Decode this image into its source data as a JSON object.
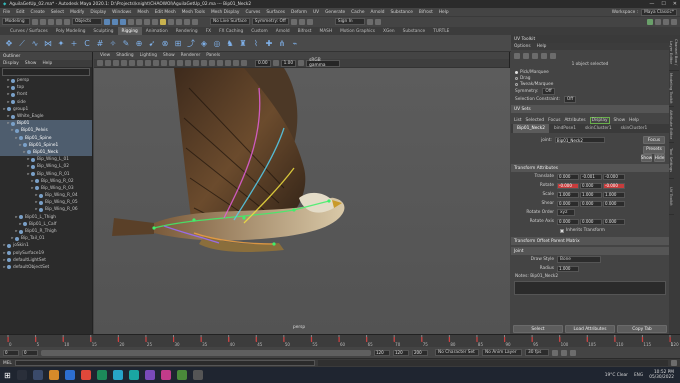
{
  "window": {
    "title": "AguilaGetUp_02.ma* - Autodesk Maya 2020.1: D:\\Projects\\knight\\CHAOWOI\\AguilaGetUp_02.ma --- Bip01_Neck2",
    "controls": [
      "—",
      "☐",
      "✕"
    ]
  },
  "menubar": [
    "File",
    "Edit",
    "Create",
    "Select",
    "Modify",
    "Display",
    "Windows",
    "Mesh",
    "Edit Mesh",
    "Mesh Tools",
    "Mesh Display",
    "Curves",
    "Surfaces",
    "Deform",
    "UV",
    "Generate",
    "Cache",
    "Arnold",
    "Substance",
    "Bifrost",
    "Help"
  ],
  "workspace": {
    "label": "Workspace :",
    "value": "Maya Classic*"
  },
  "statusline": {
    "mode": "Modeling",
    "objects": "Objects",
    "live_surface": "No Live Surface",
    "symmetry": "Symmetry: Off",
    "signin": "Sign In"
  },
  "shelf_tabs": [
    "Curves / Surfaces",
    "Poly Modeling",
    "Sculpting",
    "Rigging",
    "Animation",
    "Rendering",
    "FX",
    "FX Caching",
    "Custom",
    "Arnold",
    "Bifrost",
    "MASH",
    "Motion Graphics",
    "XGen",
    "Substance",
    "TURTLE"
  ],
  "shelf_active": "Rigging",
  "outliner": {
    "title": "Outliner",
    "menu": [
      "Display",
      "Show",
      "Help"
    ],
    "items": [
      {
        "label": "persp",
        "depth": 1,
        "sel": false
      },
      {
        "label": "top",
        "depth": 1,
        "sel": false
      },
      {
        "label": "front",
        "depth": 1,
        "sel": false
      },
      {
        "label": "side",
        "depth": 1,
        "sel": false
      },
      {
        "label": "group1",
        "depth": 0,
        "sel": false
      },
      {
        "label": "White_Eagle",
        "depth": 1,
        "sel": false
      },
      {
        "label": "Bip01",
        "depth": 1,
        "sel": true
      },
      {
        "label": "Bip01_Pelvis",
        "depth": 2,
        "sel": true
      },
      {
        "label": "Bip01_Spine",
        "depth": 3,
        "sel": true
      },
      {
        "label": "Bip01_Spine1",
        "depth": 4,
        "sel": true
      },
      {
        "label": "Bip01_Neck",
        "depth": 5,
        "sel": true
      },
      {
        "label": "Bip_Wing_L_01",
        "depth": 6,
        "sel": false
      },
      {
        "label": "Bip_Wing_L_02",
        "depth": 6,
        "sel": false
      },
      {
        "label": "Bip_Wing_R_01",
        "depth": 6,
        "sel": false
      },
      {
        "label": "Bip_Wing_R_02",
        "depth": 7,
        "sel": false
      },
      {
        "label": "Bip_Wing_R_03",
        "depth": 7,
        "sel": false
      },
      {
        "label": "Bip_Wing_R_04",
        "depth": 8,
        "sel": false
      },
      {
        "label": "Bip_Wing_R_05",
        "depth": 8,
        "sel": false
      },
      {
        "label": "Bip_Wing_R_06",
        "depth": 8,
        "sel": false
      },
      {
        "label": "Bip01_L_Thigh",
        "depth": 3,
        "sel": false
      },
      {
        "label": "Bip01_L_Calf",
        "depth": 4,
        "sel": false
      },
      {
        "label": "Bip01_R_Thigh",
        "depth": 3,
        "sel": false
      },
      {
        "label": "Bip_Tail_01",
        "depth": 2,
        "sel": false
      },
      {
        "label": "joSkin1",
        "depth": 0,
        "sel": false
      },
      {
        "label": "polySurface19",
        "depth": 0,
        "sel": false
      },
      {
        "label": "defaultLightSet",
        "depth": 0,
        "sel": false
      },
      {
        "label": "defaultObjectSet",
        "depth": 0,
        "sel": false
      }
    ]
  },
  "viewport": {
    "menu": [
      "View",
      "Shading",
      "Lighting",
      "Show",
      "Renderer",
      "Panels"
    ],
    "field1": "0.00",
    "field2": "1.00",
    "colorspace": "sRGB gamma",
    "camera_label": "persp"
  },
  "uv_toolkit": {
    "title": "UV Toolkit",
    "menu": [
      "Options",
      "Help"
    ],
    "selected": "1 object selected",
    "pick": "Pick/Marquee",
    "drag": "Drag",
    "tweak": "Tweak/Marquee",
    "symmetry": "Symmetry:",
    "symmetry_val": "Off",
    "constraint": "Selection Constraint:",
    "constraint_val": "Off",
    "uv_sets": "UV Sets"
  },
  "attr_editor": {
    "menu": [
      "List",
      "Selected",
      "Focus",
      "Attributes",
      "Display",
      "Show",
      "Help"
    ],
    "active_menu": "Display",
    "tabs": [
      "Bip01_Neck2",
      "bindPose1",
      "skinCluster1",
      "skinCluster1"
    ],
    "node_label": "joint:",
    "node_value": "Bip01_Neck2",
    "buttons": [
      "Focus",
      "Presets"
    ],
    "show_hide": [
      "Show",
      "Hide"
    ],
    "section": "Transform Attributes",
    "rows": [
      {
        "label": "Translate",
        "vals": [
          "0.000",
          "-0.001",
          "-0.000"
        ],
        "red": [
          false,
          false,
          false
        ]
      },
      {
        "label": "Rotate",
        "vals": [
          "-0.000",
          "0.000",
          "-0.000"
        ],
        "red": [
          true,
          false,
          true
        ]
      },
      {
        "label": "Scale",
        "vals": [
          "1.000",
          "1.000",
          "1.000"
        ],
        "red": [
          false,
          false,
          false
        ]
      },
      {
        "label": "Shear",
        "vals": [
          "0.000",
          "0.000",
          "0.000"
        ],
        "red": [
          false,
          false,
          false
        ]
      }
    ],
    "rotate_order_label": "Rotate Order",
    "rotate_order": "xyz",
    "rotate_axis_label": "Rotate Axis",
    "rotate_axis": [
      "0.000",
      "0.000",
      "0.000"
    ],
    "inherits": "Inherits Transform",
    "section2": "Transform Offset Parent Matrix",
    "section3": "Joint",
    "draw_style_label": "Draw Style",
    "draw_style": "Bone",
    "radius_label": "Radius",
    "radius": "1.000",
    "notes": "Notes: Bip01_Neck2",
    "footer": [
      "Select",
      "Load Attributes",
      "Copy Tab"
    ]
  },
  "side_tabs": [
    "Channel Box / Layer Editor",
    "Modeling Toolkit",
    "Attribute Editor",
    "Tool Settings",
    "UV Toolkit"
  ],
  "timeline": {
    "ticks": [
      "0",
      "5",
      "10",
      "15",
      "20",
      "25",
      "30",
      "35",
      "40",
      "45",
      "50",
      "55",
      "60",
      "65",
      "70",
      "75",
      "80",
      "85",
      "90",
      "95",
      "100",
      "105",
      "110",
      "115",
      "120"
    ],
    "current": "1"
  },
  "range": {
    "start": "0",
    "start_inner": "0",
    "end_inner": "120",
    "end": "120",
    "end2": "200",
    "char_set": "No Character Set",
    "anim_layer": "No Anim Layer",
    "fps": "30 fps"
  },
  "cmdline": {
    "mel": "MEL"
  },
  "taskbar": {
    "weather": "19°C  Clear",
    "time": "10:52 PM",
    "date": "05/30/2022",
    "lang": "ENG"
  },
  "colors": {
    "accent_sel": "#4e5d6e",
    "red_key": "#c73c3c",
    "active_tab": "#5b5b5b"
  }
}
